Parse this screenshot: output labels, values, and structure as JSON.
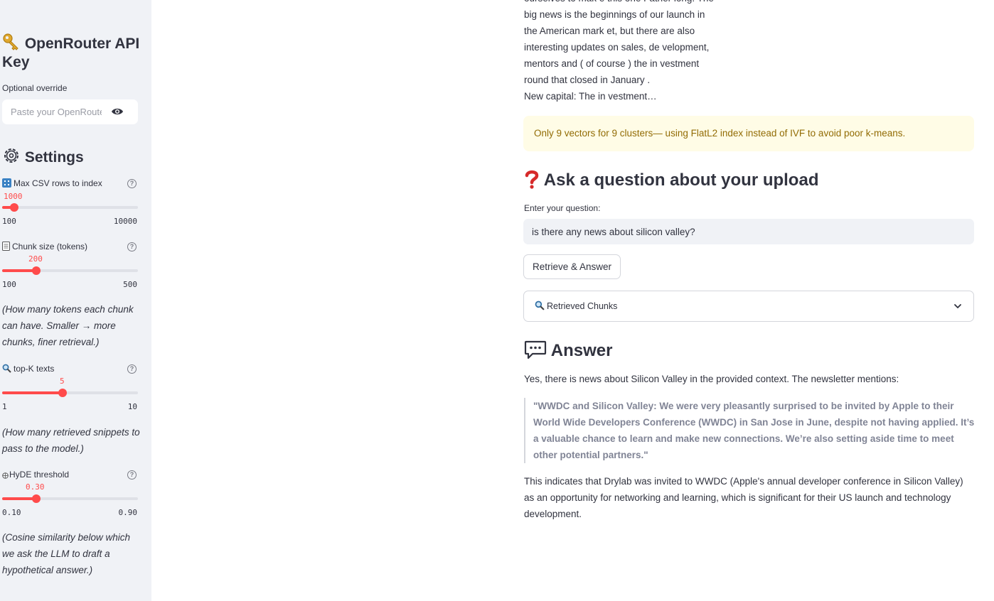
{
  "sidebar": {
    "api_key": {
      "icon": "key-icon",
      "title": "OpenRouter API Key",
      "label": "Optional override",
      "placeholder": "Paste your OpenRouter API key"
    },
    "settings": {
      "icon": "gear-icon",
      "title": "Settings",
      "help_glyph": "?",
      "sliders": [
        {
          "icon": "grid-icon",
          "label": "Max CSV rows to index",
          "value": "1000",
          "min": "100",
          "max": "10000",
          "fraction": 0.091
        },
        {
          "icon": "page-icon",
          "label": "Chunk size (tokens)",
          "value": "200",
          "min": "100",
          "max": "500",
          "fraction": 0.25,
          "note": "(How many tokens each chunk can have. Smaller → more chunks, finer retrieval.)"
        },
        {
          "icon": "magnifier-icon",
          "label": "top-K texts",
          "value": "5",
          "min": "1",
          "max": "10",
          "fraction": 0.444,
          "note": "(How many retrieved snippets to pass to the model.)"
        },
        {
          "icon": "brain-icon",
          "label": "HyDE threshold",
          "value": "0.30",
          "min": "0.10",
          "max": "0.90",
          "fraction": 0.25,
          "note": "(Cosine similarity below which we ask the LLM to draft a hypothetical answer.)"
        }
      ]
    }
  },
  "main": {
    "doc_preview": [
      "ourselves to mak e this one Father long. The",
      "big news is the beginnings of our launch in",
      "the American mark et, but there are also",
      "interesting updates on sales, de velopment,",
      "mentors and ( of course ) the in vestment",
      "round that closed in January .",
      "New capital: The in vestment…"
    ],
    "warning": "Only 9 vectors for 9 clusters— using FlatL2 index instead of IVF to avoid poor k-means.",
    "question_section": {
      "icon": "question-mark-icon",
      "title": "Ask a question about your upload",
      "input_label": "Enter your question:",
      "input_value": "is there any news about silicon valley?",
      "button_label": "Retrieve & Answer",
      "expander_label": "Retrieved Chunks",
      "expander_icon": "magnifier-icon"
    },
    "answer_section": {
      "icon": "speech-bubble-icon",
      "title": "Answer",
      "intro": "Yes, there is news about Silicon Valley in the provided context. The newsletter mentions:",
      "quote": "\"WWDC and Silicon Valley: We were very pleasantly surprised to be invited by Apple to their World Wide Developers Conference (WWDC) in San Jose in June, despite not having applied. It’s a valuable chance to learn and make new connections. We’re also setting aside time to meet other potential partners.\"",
      "conclusion": "This indicates that Drylab was invited to WWDC (Apple's annual developer conference in Silicon Valley) as an opportunity for networking and learning, which is significant for their US launch and technology development."
    }
  },
  "colors": {
    "accent": "#ff4b4b",
    "sidebar_bg": "#f0f2f6",
    "warning_bg": "#fffce6",
    "warning_text": "#926c05",
    "text": "#31333f"
  }
}
